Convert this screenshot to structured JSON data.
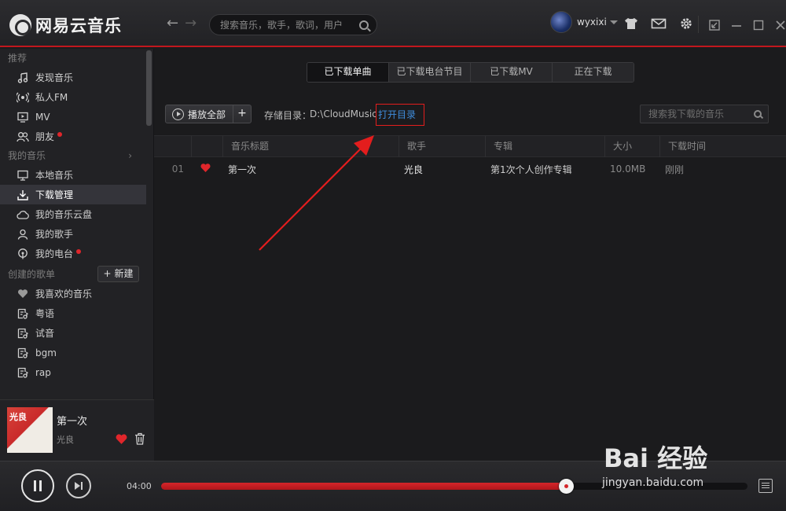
{
  "app": {
    "title": "网易云音乐"
  },
  "header": {
    "search_placeholder": "搜索音乐，歌手，歌词，用户",
    "username": "wyxixi"
  },
  "sidebar": {
    "sections": [
      {
        "title": "推荐",
        "items": [
          {
            "label": "发现音乐",
            "icon": "music-note-icon"
          },
          {
            "label": "私人FM",
            "icon": "radio-icon"
          },
          {
            "label": "MV",
            "icon": "mv-icon"
          },
          {
            "label": "朋友",
            "icon": "friends-icon",
            "badge": true
          }
        ]
      },
      {
        "title": "我的音乐",
        "items": [
          {
            "label": "本地音乐",
            "icon": "computer-icon"
          },
          {
            "label": "下载管理",
            "icon": "download-icon",
            "active": true
          },
          {
            "label": "我的音乐云盘",
            "icon": "cloud-icon"
          },
          {
            "label": "我的歌手",
            "icon": "singer-icon"
          },
          {
            "label": "我的电台",
            "icon": "station-icon",
            "badge": true
          }
        ]
      },
      {
        "title": "创建的歌单",
        "new_label": "新建",
        "items": [
          {
            "label": "我喜欢的音乐",
            "icon": "heart-icon"
          },
          {
            "label": "粤语",
            "icon": "playlist-icon"
          },
          {
            "label": "试音",
            "icon": "playlist-icon"
          },
          {
            "label": "bgm",
            "icon": "playlist-icon"
          },
          {
            "label": "rap",
            "icon": "playlist-icon"
          }
        ]
      }
    ],
    "now_playing": {
      "title": "第一次",
      "artist": "光良"
    }
  },
  "main": {
    "tabs": [
      {
        "label": "已下载单曲",
        "active": true
      },
      {
        "label": "已下载电台节目",
        "active": false
      },
      {
        "label": "已下载MV",
        "active": false
      },
      {
        "label": "正在下载",
        "active": false
      }
    ],
    "play_all_label": "播放全部",
    "add_label": "+",
    "storage_label": "存储目录：",
    "storage_path": "D:\\CloudMusic",
    "open_dir_label": "打开目录",
    "search_placeholder": "搜索我下载的音乐",
    "columns": [
      "",
      "",
      "音乐标题",
      "歌手",
      "专辑",
      "大小",
      "下载时间"
    ],
    "rows": [
      {
        "index": "01",
        "liked": true,
        "title": "第一次",
        "artist": "光良",
        "album": "第1次个人创作专辑",
        "size": "10.0MB",
        "time": "刚刚"
      }
    ]
  },
  "player": {
    "current_time": "04:00",
    "progress_fraction": 0.69
  },
  "watermark": {
    "brand": "Bai 经验",
    "url": "jingyan.baidu.com"
  },
  "colors": {
    "accent": "#c2171d",
    "link": "#3f8ddd",
    "background": "#1b1b1d"
  }
}
